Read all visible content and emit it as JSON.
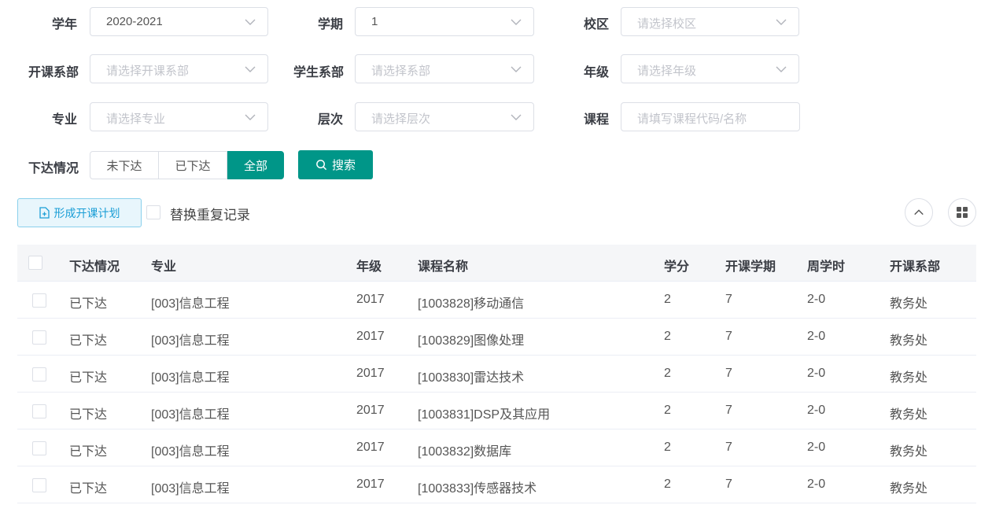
{
  "filters": {
    "year": {
      "label": "学年",
      "value": "2020-2021"
    },
    "term": {
      "label": "学期",
      "value": "1"
    },
    "campus": {
      "label": "校区",
      "placeholder": "请选择校区"
    },
    "course_dept": {
      "label": "开课系部",
      "placeholder": "请选择开课系部"
    },
    "student_dept": {
      "label": "学生系部",
      "placeholder": "请选择系部"
    },
    "grade": {
      "label": "年级",
      "placeholder": "请选择年级"
    },
    "major": {
      "label": "专业",
      "placeholder": "请选择专业"
    },
    "level": {
      "label": "层次",
      "placeholder": "请选择层次"
    },
    "course": {
      "label": "课程",
      "placeholder": "请填写课程代码/名称"
    },
    "status": {
      "label": "下达情况",
      "options": [
        "未下达",
        "已下达",
        "全部"
      ],
      "selected": "全部"
    }
  },
  "buttons": {
    "search": "搜索",
    "form_plan": "形成开课计划"
  },
  "replace_dup_label": "替换重复记录",
  "table": {
    "columns": [
      "下达情况",
      "专业",
      "年级",
      "课程名称",
      "学分",
      "开课学期",
      "周学时",
      "开课系部"
    ],
    "rows": [
      [
        "已下达",
        "[003]信息工程",
        "2017",
        "[1003828]移动通信",
        "2",
        "7",
        "2-0",
        "教务处"
      ],
      [
        "已下达",
        "[003]信息工程",
        "2017",
        "[1003829]图像处理",
        "2",
        "7",
        "2-0",
        "教务处"
      ],
      [
        "已下达",
        "[003]信息工程",
        "2017",
        "[1003830]雷达技术",
        "2",
        "7",
        "2-0",
        "教务处"
      ],
      [
        "已下达",
        "[003]信息工程",
        "2017",
        "[1003831]DSP及其应用",
        "2",
        "7",
        "2-0",
        "教务处"
      ],
      [
        "已下达",
        "[003]信息工程",
        "2017",
        "[1003832]数据库",
        "2",
        "7",
        "2-0",
        "教务处"
      ],
      [
        "已下达",
        "[003]信息工程",
        "2017",
        "[1003833]传感器技术",
        "2",
        "7",
        "2-0",
        "教务处"
      ]
    ]
  },
  "colors": {
    "primary": "#009688",
    "accent_blue": "#1a9ed6"
  },
  "icons": {
    "chevron": "chevron-down-icon",
    "search": "search-icon",
    "doc": "document-add-icon",
    "collapse": "chevron-up-icon",
    "grid": "grid-icon"
  }
}
